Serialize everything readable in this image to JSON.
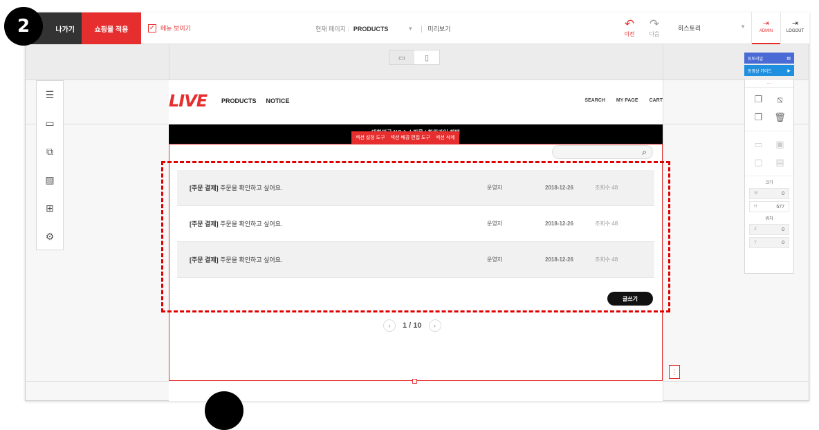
{
  "step_badge": "2",
  "topbar": {
    "exit_label": "나가기",
    "apply_label": "쇼핑몰 적용",
    "menu_toggle_label": "메뉴 보이기",
    "current_page_label": "현재 페이지 :",
    "current_page_value": "PRODUCTS",
    "preview_label": "미리보기",
    "undo_label": "이전",
    "redo_label": "다음",
    "history_label": "히스토리",
    "admin_label": "ADMIN",
    "logout_label": "LOGOUT"
  },
  "site": {
    "logo": "LIVE",
    "nav_left": [
      "PRODUCTS",
      "NOTICE"
    ],
    "nav_right": [
      "SEARCH",
      "MY PAGE",
      "CART"
    ],
    "banner_text": "대한민국 NO.1 쇼핑몰 | 회원가입 혜택",
    "section_tools": [
      "섹션 설정 도구",
      "섹션 배경 편집 도구",
      "섹션 삭제"
    ]
  },
  "board": {
    "rows": [
      {
        "category": "[주문 결제]",
        "title": "주문을 확인하고 싶어요.",
        "author": "운영자",
        "date": "2018-12-26",
        "views": "조회수 48"
      },
      {
        "category": "[주문 결제]",
        "title": "주문을 확인하고 싶어요.",
        "author": "운영자",
        "date": "2018-12-26",
        "views": "조회수 48"
      },
      {
        "category": "[주문 결제]",
        "title": "주문을 확인하고 싶어요.",
        "author": "운영자",
        "date": "2018-12-26",
        "views": "조회수 48"
      }
    ],
    "write_button": "글쓰기",
    "pagination": "1 / 10"
  },
  "right_panel": {
    "tutorial_label": "튜토리얼",
    "video_guide_label": "동영상 가이드",
    "size_label": "크기",
    "position_label": "위치",
    "fields": {
      "w_label": "W",
      "w_value": "0",
      "h_label": "H",
      "h_value": "577",
      "x_label": "X",
      "x_value": "0",
      "y_label": "Y",
      "y_value": "0"
    }
  },
  "icons": {
    "left_tools": [
      "menu-lines-icon",
      "section-icon",
      "column-icon",
      "image-icon",
      "widgets-grid-icon",
      "settings-gear-icon"
    ],
    "accent_color": "#e62e2e"
  }
}
